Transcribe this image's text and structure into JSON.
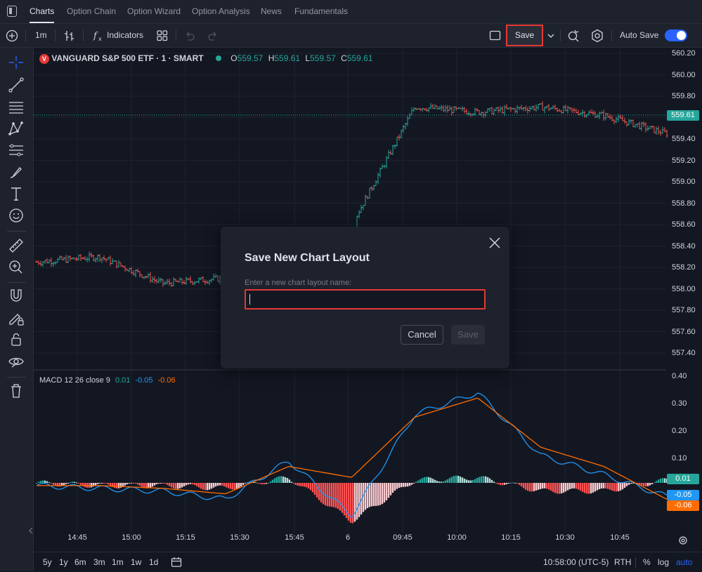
{
  "nav": {
    "tabs": [
      {
        "label": "Charts",
        "active": true
      },
      {
        "label": "Option Chain"
      },
      {
        "label": "Option Wizard"
      },
      {
        "label": "Option Analysis"
      },
      {
        "label": "News"
      },
      {
        "label": "Fundamentals"
      }
    ]
  },
  "toolbar": {
    "interval": "1m",
    "indicators_label": "Indicators",
    "save_label": "Save",
    "autosave_label": "Auto Save",
    "autosave_on": true
  },
  "legend": {
    "symbol": "VANGUARD S&P 500 ETF · 1 · SMART",
    "logo_letter": "V",
    "o_key": "O",
    "o_val": "559.57",
    "h_key": "H",
    "h_val": "559.61",
    "l_key": "L",
    "l_val": "559.57",
    "c_key": "C",
    "c_val": "559.61"
  },
  "macd_legend": {
    "name": "MACD 12 26 close 9",
    "hist": "0.01",
    "macd": "-0.05",
    "signal": "-0.06"
  },
  "price_axis": {
    "ticks": [
      "560.20",
      "560.00",
      "559.80",
      "559.60",
      "559.40",
      "559.20",
      "559.00",
      "558.80",
      "558.60",
      "558.40",
      "558.20",
      "558.00",
      "557.80",
      "557.60",
      "557.40"
    ],
    "current_price": "559.61",
    "macd_ticks": [
      "0.40",
      "0.30",
      "0.20",
      "0.10"
    ],
    "macd_last_hist": "0.01",
    "macd_last_macd": "-0.05",
    "macd_last_signal": "-0.06"
  },
  "time_axis": {
    "ticks": [
      "14:45",
      "15:00",
      "15:15",
      "15:30",
      "15:45",
      "6",
      "09:45",
      "10:00",
      "10:15",
      "10:30",
      "10:45"
    ]
  },
  "bottom": {
    "ranges": [
      "5y",
      "1y",
      "6m",
      "3m",
      "1m",
      "1w",
      "1d"
    ],
    "clock": "10:58:00 (UTC-5)",
    "session": "RTH",
    "percent": "%",
    "log": "log",
    "auto": "auto"
  },
  "dialog": {
    "title": "Save New Chart Layout",
    "input_label": "Enter a new chart layout name:",
    "input_value": "",
    "cancel_label": "Cancel",
    "save_label": "Save"
  },
  "colors": {
    "up": "#26a69a",
    "down": "#ef5350",
    "macd_line": "#2196f3",
    "signal_line": "#ff6d00",
    "accent": "#2962ff",
    "highlight": "#e53935"
  },
  "chart_data": {
    "type": "line",
    "price_series_approx": {
      "name": "VANGUARD S&P 500 ETF",
      "x": [
        "14:45",
        "15:00",
        "15:15",
        "15:30",
        "15:45",
        "6",
        "09:45",
        "10:00",
        "10:15",
        "10:30",
        "10:45"
      ],
      "values": [
        558.25,
        558.3,
        558.05,
        558.1,
        558.2,
        558.6,
        559.7,
        559.65,
        559.7,
        559.62,
        559.45
      ]
    },
    "ylim": [
      557.3,
      560.2
    ],
    "macd": {
      "x": [
        "14:45",
        "15:00",
        "15:15",
        "15:30",
        "15:45",
        "6",
        "09:45",
        "10:00",
        "10:15",
        "10:30",
        "10:45"
      ],
      "macd": [
        -0.01,
        -0.02,
        -0.03,
        -0.06,
        0.08,
        -0.12,
        0.25,
        0.33,
        0.1,
        0.03,
        -0.05
      ],
      "signal": [
        -0.01,
        -0.01,
        -0.02,
        -0.04,
        0.06,
        0.02,
        0.24,
        0.31,
        0.13,
        0.06,
        -0.06
      ],
      "ylim": [
        -0.12,
        0.4
      ]
    }
  }
}
